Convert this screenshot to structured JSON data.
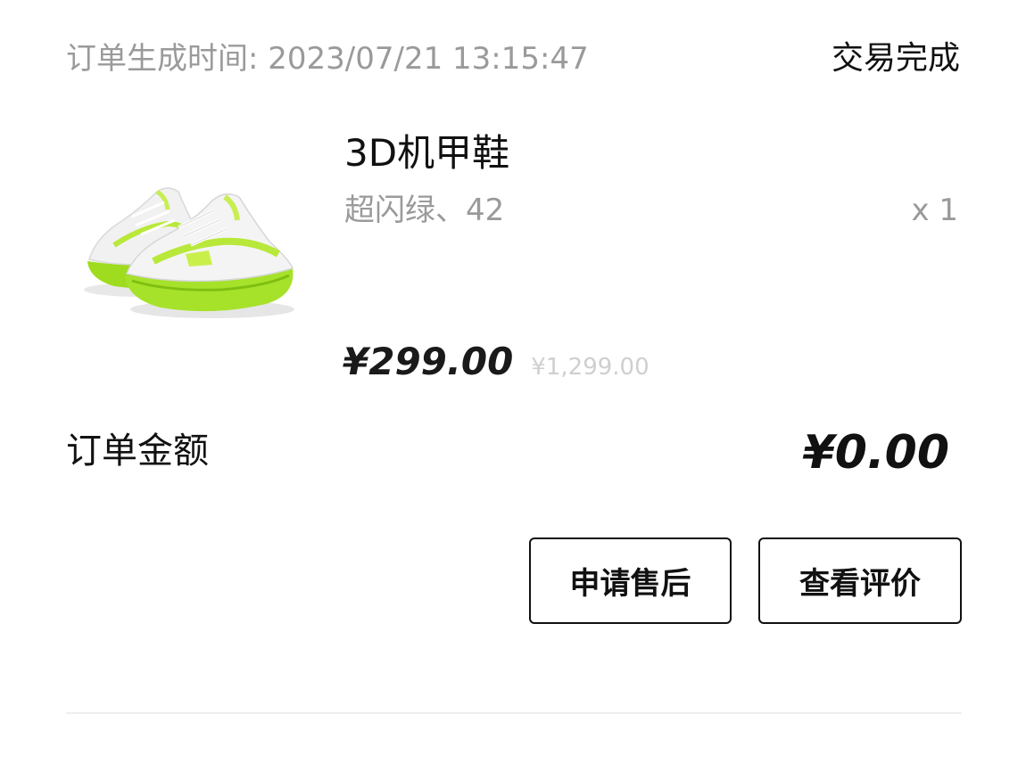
{
  "order": {
    "time_label": "订单生成时间: 2023/07/21 13:15:47",
    "status": "交易完成"
  },
  "product": {
    "name": "3D机甲鞋",
    "variant": "超闪绿、42",
    "quantity": "x 1",
    "price": "¥299.00",
    "original_price": "¥1,299.00",
    "image_icon": "sneaker-product-image",
    "colors": {
      "accent_green": "#a6e22a",
      "upper_white": "#f2f2f2"
    }
  },
  "total": {
    "label": "订单金额",
    "value": "¥0.00"
  },
  "actions": {
    "aftersale_label": "申请售后",
    "review_label": "查看评价"
  }
}
